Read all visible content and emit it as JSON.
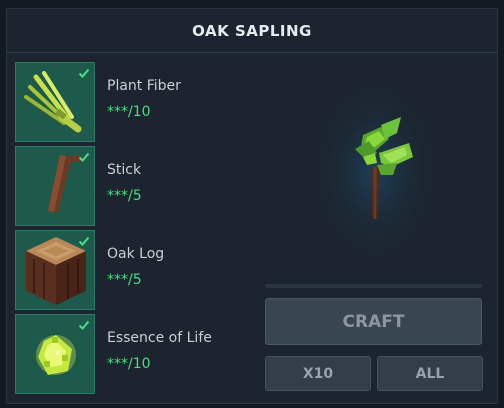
{
  "title": "OAK SAPLING",
  "ingredients": [
    {
      "name": "Plant Fiber",
      "qty": "***/10",
      "icon": "plant-fiber-icon"
    },
    {
      "name": "Stick",
      "qty": "***/5",
      "icon": "stick-icon"
    },
    {
      "name": "Oak Log",
      "qty": "***/5",
      "icon": "oak-log-icon"
    },
    {
      "name": "Essence of Life",
      "qty": "***/10",
      "icon": "essence-of-life-icon"
    }
  ],
  "buttons": {
    "craft": "CRAFT",
    "x10": "X10",
    "all": "ALL"
  },
  "colors": {
    "slot_bg": "#1d5a4c",
    "check": "#4ade80",
    "qty_text": "#4ade80"
  }
}
